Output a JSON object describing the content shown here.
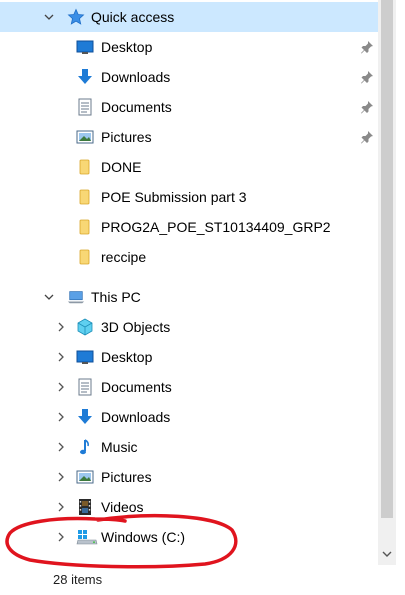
{
  "quick_access": {
    "label": "Quick access",
    "items": [
      {
        "label": "Desktop",
        "icon": "desktop-icon",
        "pinned": true
      },
      {
        "label": "Downloads",
        "icon": "download-arrow-icon",
        "pinned": true
      },
      {
        "label": "Documents",
        "icon": "document-icon",
        "pinned": true
      },
      {
        "label": "Pictures",
        "icon": "pictures-icon",
        "pinned": true
      },
      {
        "label": "DONE",
        "icon": "folder-icon",
        "pinned": false
      },
      {
        "label": "POE Submission part 3",
        "icon": "folder-icon",
        "pinned": false
      },
      {
        "label": "PROG2A_POE_ST10134409_GRP2",
        "icon": "folder-icon",
        "pinned": false
      },
      {
        "label": "reccipe",
        "icon": "folder-icon",
        "pinned": false
      }
    ]
  },
  "this_pc": {
    "label": "This PC",
    "items": [
      {
        "label": "3D Objects",
        "icon": "3d-objects-icon"
      },
      {
        "label": "Desktop",
        "icon": "desktop-icon"
      },
      {
        "label": "Documents",
        "icon": "document-icon"
      },
      {
        "label": "Downloads",
        "icon": "download-arrow-icon"
      },
      {
        "label": "Music",
        "icon": "music-note-icon"
      },
      {
        "label": "Pictures",
        "icon": "pictures-icon"
      },
      {
        "label": "Videos",
        "icon": "video-film-icon"
      },
      {
        "label": "Windows (C:)",
        "icon": "windows-drive-icon"
      }
    ]
  },
  "status_bar": {
    "item_count": "28 items"
  },
  "colors": {
    "selection": "#cce8ff",
    "annotation": "#e0141e",
    "folder": "#f8d775",
    "accent_blue": "#1e7bd6"
  }
}
